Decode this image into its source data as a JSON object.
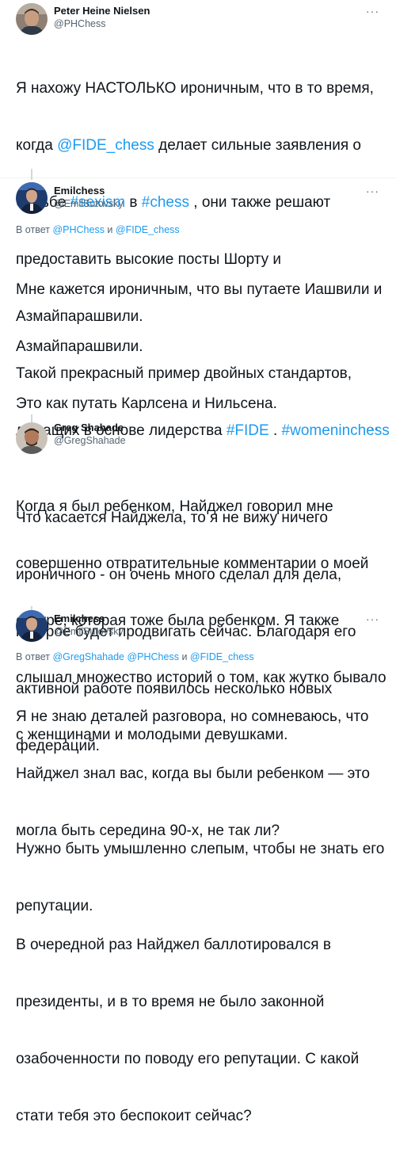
{
  "tweets": [
    {
      "name": "Peter Heine Nielsen",
      "handle": "@PHChess",
      "more": "···",
      "body": {
        "l1": "Я нахожу НАСТОЛЬКО ироничным, что в то время,",
        "l2a": "когда ",
        "l2b": "@FIDE_chess",
        "l2c": " делает сильные заявления о",
        "l3a": "борьбе ",
        "l3b": "#sexism",
        "l3c": " в ",
        "l3d": "#chess",
        "l3e": " , они также решают",
        "l4": "предоставить высокие посты Шорту и",
        "l5": "Азмайпарашвили.",
        "l6": "Такой прекрасный пример двойных стандартов,",
        "l7a": "лежащих в основе лидерства ",
        "l7b": "#FIDE",
        "l7c": " . ",
        "l7d": "#womeninchess"
      }
    },
    {
      "name": "Emilchess",
      "handle": "@EmilSutovsky",
      "more": "···",
      "reply_prefix": "В ответ ",
      "reply_a": "@PHChess",
      "reply_and": " и ",
      "reply_b": "@FIDE_chess",
      "body": {
        "l1": "Мне кажется ироничным, что вы путаете Иашвили и",
        "l2": "Азмайпарашвили.",
        "l3": "Это как путать Карлсена и Нильсена.",
        "l4": "Что касается Найджела, то я не вижу ничего",
        "l5": "ироничного - он очень много сделал для дела,",
        "l6": "которое будет продвигать сейчас. Благодаря его",
        "l7": "активной работе появилось несколько новых",
        "l8": "федераций."
      }
    },
    {
      "name": "Greg Shahade",
      "handle": "@GregShahade",
      "more": "···",
      "body": {
        "l1": "Когда я был ребенком, Найджел говорил мне",
        "l2": "совершенно отвратительные комментарии о моей",
        "l3": "сестре, которая тоже была ребенком. Я также",
        "l4": "слышал множество историй о том, как жутко бывало",
        "l5": "с женщинами и молодыми девушками.",
        "l6": "Нужно быть умышленно слепым, чтобы не знать его",
        "l7": "репутации."
      }
    },
    {
      "name": "Emilchess",
      "handle": "@EmilSutovsky",
      "more": "···",
      "reply_prefix": "В ответ ",
      "reply_a": "@GregShahade",
      "reply_sep": " ",
      "reply_b": "@PHChess",
      "reply_and": " и ",
      "reply_c": "@FIDE_chess",
      "body": {
        "l1": "Я не знаю деталей разговора, но сомневаюсь, что",
        "l2": "Найджел знал вас, когда вы были ребенком — это",
        "l3": "могла быть середина 90-х, не так ли?",
        "l4": "В очередной раз Найджел баллотировался в",
        "l5": "президенты, и в то время не было законной",
        "l6": "озабоченности по поводу его репутации. С какой",
        "l7": "стати тебя это беспокоит сейчас?"
      }
    }
  ],
  "colors": {
    "link": "#1d9bf0",
    "muted": "#536471",
    "text": "#0f1419",
    "thread": "#cfd9de"
  }
}
